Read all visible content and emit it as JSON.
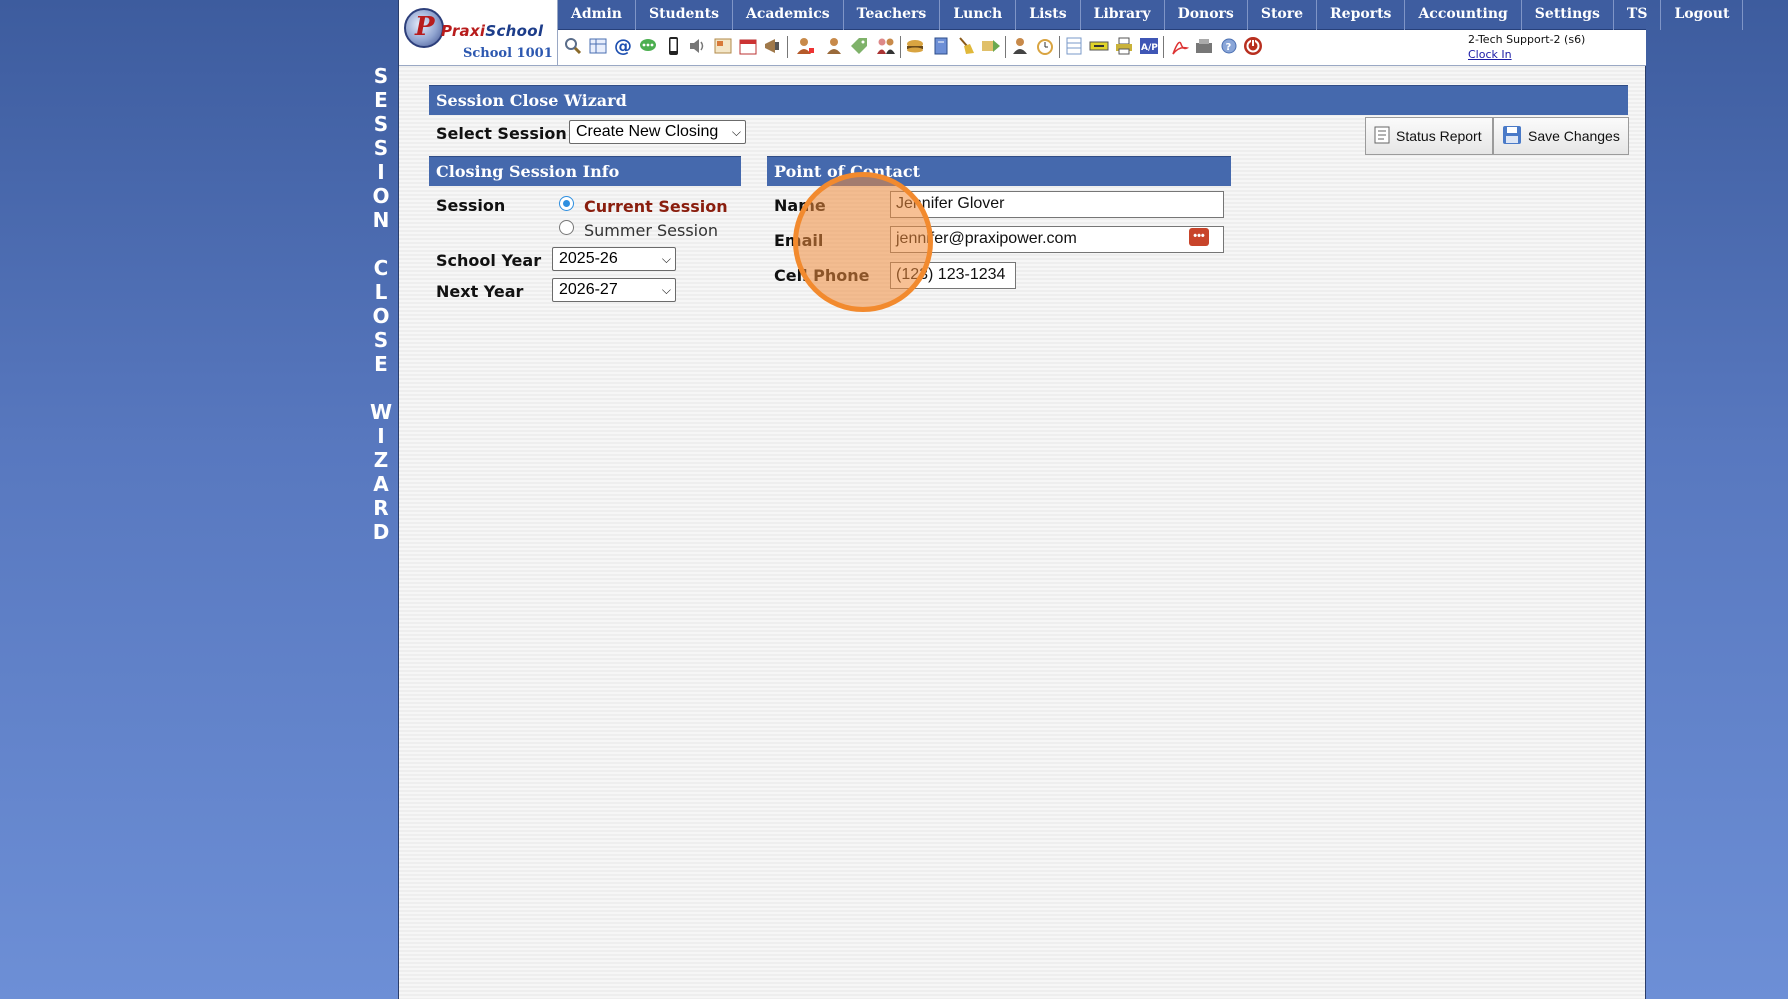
{
  "side_title": [
    "S",
    "E",
    "S",
    "S",
    "I",
    "O",
    "N",
    "",
    "C",
    "L",
    "O",
    "S",
    "E",
    "",
    "W",
    "I",
    "Z",
    "A",
    "R",
    "D"
  ],
  "logo": {
    "brand_a": "Praxi",
    "brand_b": "School",
    "mark": "P",
    "school_name": "School 1001"
  },
  "menu": [
    "Admin",
    "Students",
    "Academics",
    "Teachers",
    "Lunch",
    "Lists",
    "Library",
    "Donors",
    "Store",
    "Reports",
    "Accounting",
    "Settings",
    "TS",
    "Logout"
  ],
  "toolbar_icons": [
    "search-icon",
    "calendar-grid-icon",
    "at-sign-icon",
    "chat-icon",
    "mobile-phone-icon",
    "speaker-icon",
    "newsletter-icon",
    "calendar-icon",
    "megaphone-icon",
    "student-add-icon",
    "student-icon",
    "tag-icon",
    "parents-icon",
    "lunch-icon",
    "notebook-icon",
    "broom-icon",
    "forward-icon",
    "teacher-icon",
    "clock-icon",
    "spreadsheet-icon",
    "ticket-icon",
    "printer-icon",
    "accounts-payable-icon",
    "pdf-icon",
    "cash-register-icon",
    "help-icon",
    "power-icon"
  ],
  "user": {
    "label": "2-Tech Support-2 (s6)",
    "clock_in": "Clock In"
  },
  "wizard": {
    "header": "Session Close Wizard",
    "select_session_label": "Select Session",
    "select_session_value": "Create New Closing",
    "status_report_button": "Status Report",
    "save_changes_button": "Save Changes"
  },
  "closing_info": {
    "header": "Closing Session Info",
    "session_label": "Session",
    "session_options": [
      "Current Session",
      "Summer Session"
    ],
    "session_selected": "Current Session",
    "school_year_label": "School Year",
    "school_year_value": "2025-26",
    "next_year_label": "Next Year",
    "next_year_value": "2026-27"
  },
  "contact": {
    "header": "Point of Contact",
    "name_label": "Name",
    "name_value": "Jennifer Glover",
    "email_label": "Email",
    "email_value": "jennifer@praxipower.com",
    "email_icon": "more-dots-icon",
    "cell_label": "Cell Phone",
    "cell_value": "(123) 123-1234"
  },
  "colors": {
    "header_blue": "#4569ad",
    "menu_blue": "#3e5da0",
    "selected_session": "#8a1e0e",
    "highlight": "#f28a2e"
  }
}
